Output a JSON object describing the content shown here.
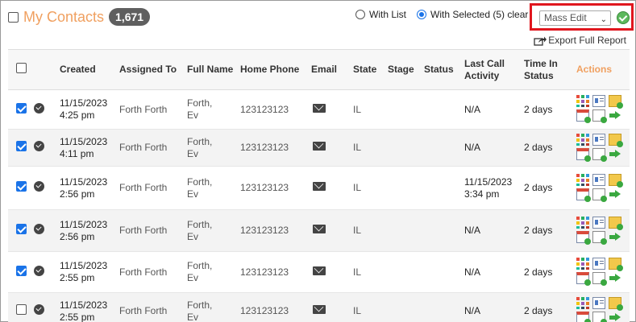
{
  "header": {
    "title": "My Contacts",
    "count": "1,671",
    "with_list_label": "With List",
    "with_selected_label": "With Selected (5) clear",
    "mass_edit_value": "Mass Edit",
    "export_label": "Export Full Report"
  },
  "table": {
    "columns": {
      "created": "Created",
      "assigned": "Assigned To",
      "name": "Full Name",
      "phone": "Home Phone",
      "email": "Email",
      "state": "State",
      "stage": "Stage",
      "status": "Status",
      "last_call_1": "Last Call",
      "last_call_2": "Activity",
      "time_1": "Time In",
      "time_2": "Status",
      "actions": "Actions"
    },
    "rows": [
      {
        "date": "11/15/2023",
        "time": "4:25 pm",
        "assigned": "Forth Forth",
        "name1": "Forth,",
        "name2": "Ev",
        "phone": "123123123",
        "state": "IL",
        "last1": "N/A",
        "last2": "",
        "time_in": "2 days",
        "checked": true
      },
      {
        "date": "11/15/2023",
        "time": "4:11 pm",
        "assigned": "Forth Forth",
        "name1": "Forth,",
        "name2": "Ev",
        "phone": "123123123",
        "state": "IL",
        "last1": "N/A",
        "last2": "",
        "time_in": "2 days",
        "checked": true
      },
      {
        "date": "11/15/2023",
        "time": "2:56 pm",
        "assigned": "Forth Forth",
        "name1": "Forth,",
        "name2": "Ev",
        "phone": "123123123",
        "state": "IL",
        "last1": "11/15/2023",
        "last2": "3:34 pm",
        "time_in": "2 days",
        "checked": true
      },
      {
        "date": "11/15/2023",
        "time": "2:56 pm",
        "assigned": "Forth Forth",
        "name1": "Forth,",
        "name2": "Ev",
        "phone": "123123123",
        "state": "IL",
        "last1": "N/A",
        "last2": "",
        "time_in": "2 days",
        "checked": true
      },
      {
        "date": "11/15/2023",
        "time": "2:55 pm",
        "assigned": "Forth Forth",
        "name1": "Forth,",
        "name2": "Ev",
        "phone": "123123123",
        "state": "IL",
        "last1": "N/A",
        "last2": "",
        "time_in": "2 days",
        "checked": true
      },
      {
        "date": "11/15/2023",
        "time": "2:55 pm",
        "assigned": "Forth Forth",
        "name1": "Forth,",
        "name2": "Ev",
        "phone": "123123123",
        "state": "IL",
        "last1": "N/A",
        "last2": "",
        "time_in": "2 days",
        "checked": false
      }
    ]
  }
}
